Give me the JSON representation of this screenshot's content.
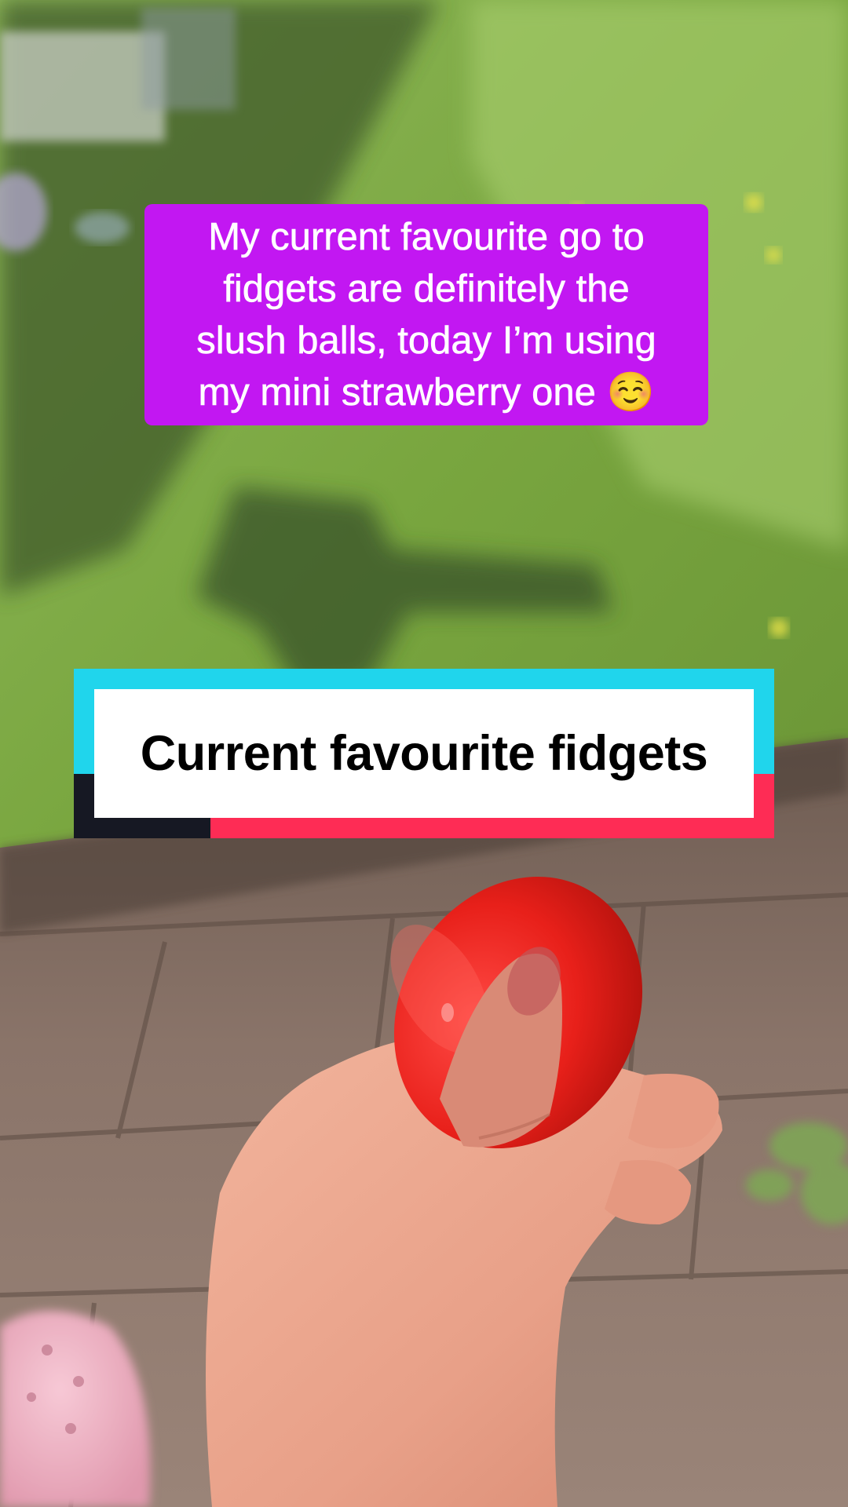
{
  "caption": {
    "lines": [
      "My current favourite go to",
      "fidgets are definitely the",
      "slush balls, today I’m using",
      "my mini strawberry one ☺️"
    ],
    "background_color": "#c217f2",
    "text_color": "#ffffff"
  },
  "title_card": {
    "text": "Current favourite fidgets",
    "colors": {
      "cyan": "#20d5ec",
      "pink": "#fe2c55",
      "dark": "#161823",
      "panel": "#ffffff"
    }
  }
}
